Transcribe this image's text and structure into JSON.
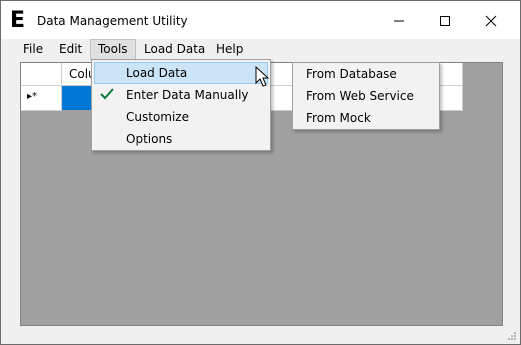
{
  "window": {
    "title": "Data Management Utility",
    "app_icon_letter": "E",
    "controls": {
      "minimize": "minimize-icon",
      "maximize": "maximize-icon",
      "close": "close-icon"
    }
  },
  "menubar": {
    "items": [
      {
        "label": "File"
      },
      {
        "label": "Edit"
      },
      {
        "label": "Tools"
      },
      {
        "label": "Load Data"
      },
      {
        "label": "Help"
      }
    ],
    "active": "Tools"
  },
  "grid": {
    "column_header": "Column1",
    "new_row_marker": "▸*",
    "selection_color": "#0078d7",
    "background_color": "#a0a0a0"
  },
  "tools_menu": {
    "items": [
      {
        "label": "Load Data",
        "has_submenu": true,
        "highlighted": true
      },
      {
        "label": "Enter Data Manually",
        "checked": true
      },
      {
        "label": "Customize"
      },
      {
        "label": "Options"
      }
    ],
    "check_color": "#0f7b3c"
  },
  "load_data_submenu": {
    "items": [
      {
        "label": "From Database"
      },
      {
        "label": "From Web Service"
      },
      {
        "label": "From Mock"
      }
    ]
  }
}
